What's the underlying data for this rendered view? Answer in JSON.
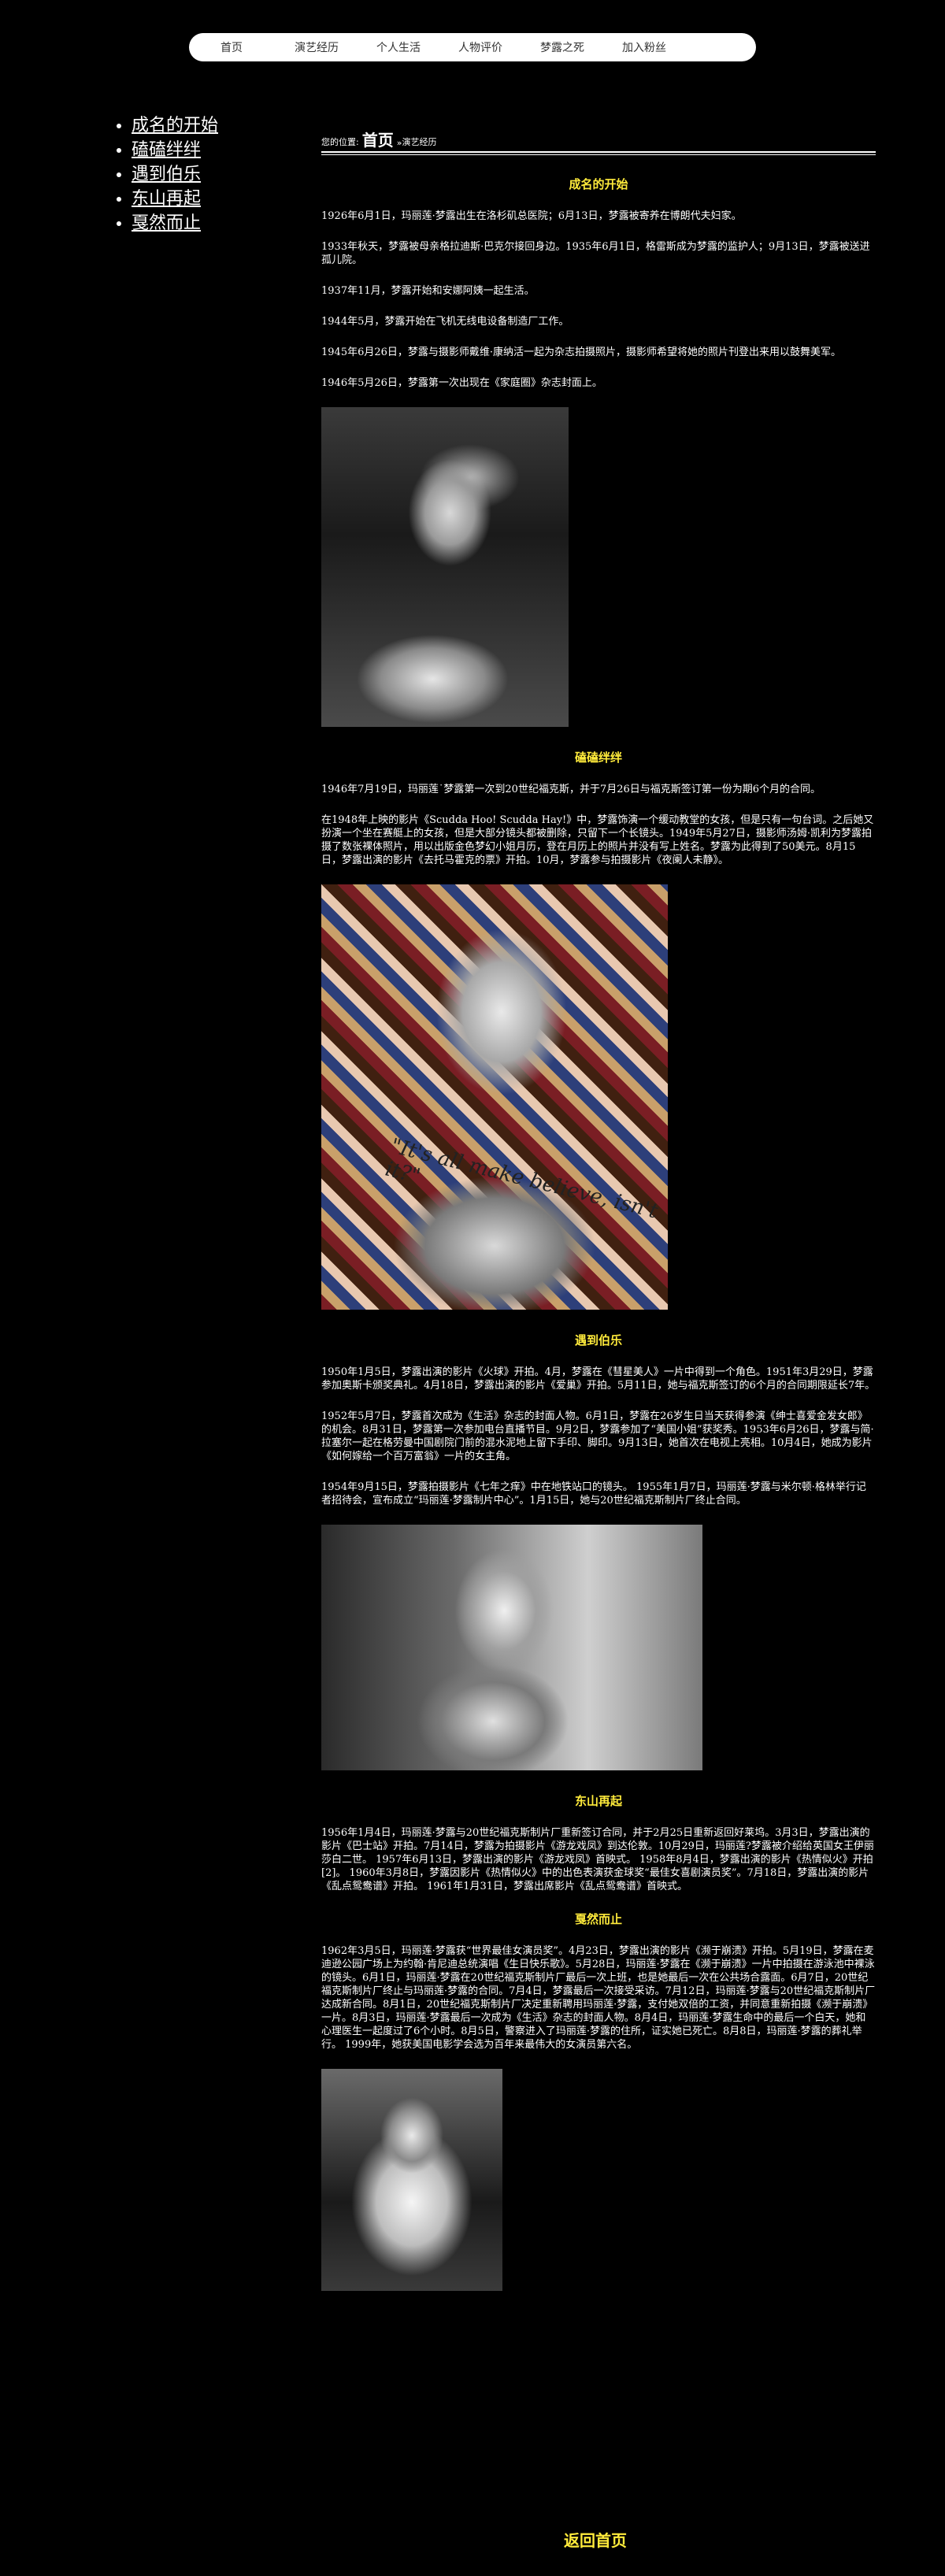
{
  "nav": {
    "items": [
      "首页",
      "演艺经历",
      "个人生活",
      "人物评价",
      "梦露之死",
      "加入粉丝"
    ]
  },
  "sidebar": {
    "items": [
      "成名的开始",
      "磕磕绊绊",
      "遇到伯乐",
      "东山再起",
      "戛然而止"
    ]
  },
  "breadcrumb": {
    "prefix": "您的位置:",
    "home": "首页",
    "separator": "»",
    "current": "演艺经历"
  },
  "sections": [
    {
      "title": "成名的开始",
      "paragraphs": [
        "1926年6月1日，玛丽莲·梦露出生在洛杉矶总医院；6月13日，梦露被寄养在博朗代夫妇家。",
        "1933年秋天，梦露被母亲格拉迪斯·巴克尔接回身边。1935年6月1日，格雷斯成为梦露的监护人；9月13日，梦露被送进孤儿院。",
        "1937年11月，梦露开始和安娜阿姨一起生活。",
        "1944年5月，梦露开始在飞机无线电设备制造厂工作。",
        "1945年6月26日，梦露与摄影师戴维·康纳活一起为杂志拍摄照片，摄影师希望将她的照片刊登出来用以鼓舞美军。",
        "1946年5月26日，梦露第一次出现在《家庭圈》杂志封面上。"
      ]
    },
    {
      "title": "磕磕绊绊",
      "paragraphs": [
        "1946年7月19日，玛丽莲˙梦露第一次到20世纪福克斯，并于7月26日与福克斯签订第一份为期6个月的合同。",
        "在1948年上映的影片《Scudda Hoo! Scudda Hay!》中，梦露饰演一个缓动教堂的女孩，但是只有一句台词。之后她又扮演一个坐在赛艇上的女孩，但是大部分镜头都被删除，只留下一个长镜头。1949年5月27日，摄影师汤姆·凯利为梦露拍摄了数张裸体照片，用以出版金色梦幻小姐月历，登在月历上的照片并没有写上姓名。梦露为此得到了50美元。8月15日，梦露出演的影片《去托马霍克的票》开拍。10月，梦露参与拍摄影片《夜阑人未静》。"
      ]
    },
    {
      "title": "遇到伯乐",
      "paragraphs": [
        "1950年1月5日，梦露出演的影片《火球》开拍。4月，梦露在《彗星美人》一片中得到一个角色。1951年3月29日，梦露参加奥斯卡颁奖典礼。4月18日，梦露出演的影片《爱巢》开拍。5月11日，她与福克斯签订的6个月的合同期限延长7年。",
        "1952年5月7日，梦露首次成为《生活》杂志的封面人物。6月1日，梦露在26岁生日当天获得参演《绅士喜爱金发女郎》的机会。8月31日，梦露第一次参加电台直播节目。9月2日，梦露参加了“美国小姐”获奖秀。1953年6月26日，梦露与简·拉塞尔一起在格劳曼中国剧院门前的混水泥地上留下手印、脚印。9月13日，她首次在电视上亮相。10月4日，她成为影片《如何嫁给一个百万富翁》一片的女主角。",
        "1954年9月15日，梦露拍摄影片《七年之痒》中在地铁站口的镜头。 1955年1月7日，玛丽莲·梦露与米尔顿·格林举行记者招待会，宣布成立“玛丽莲·梦露制片中心”。1月15日，她与20世纪福克斯制片厂终止合同。"
      ]
    },
    {
      "title": "东山再起",
      "paragraphs": [
        "1956年1月4日，玛丽莲·梦露与20世纪福克斯制片厂重新签订合同，并于2月25日重新返回好莱坞。3月3日，梦露出演的影片《巴士站》开拍。7月14日，梦露为拍摄影片《游龙戏凤》到达伦敦。10月29日，玛丽莲?梦露被介绍给英国女王伊丽莎白二世。 1957年6月13日，梦露出演的影片《游龙戏凤》首映式。 1958年8月4日，梦露出演的影片《热情似火》开拍[2]。 1960年3月8日，梦露因影片《热情似火》中的出色表演获金球奖“最佳女喜剧演员奖”。7月18日，梦露出演的影片《乱点鸳鸯谱》开拍。 1961年1月31日，梦露出席影片《乱点鸳鸯谱》首映式。"
      ]
    },
    {
      "title": "戛然而止",
      "paragraphs": [
        "1962年3月5日，玛丽莲·梦露获“世界最佳女演员奖”。4月23日，梦露出演的影片《濒于崩溃》开拍。5月19日，梦露在麦迪逊公园广场上为约翰·肯尼迪总统演唱《生日快乐歌》。5月28日，玛丽莲·梦露在《濒于崩溃》一片中拍摄在游泳池中裸泳的镜头。6月1日，玛丽莲·梦露在20世纪福克斯制片厂最后一次上班，也是她最后一次在公共场合露面。6月7日，20世纪福克斯制片厂终止与玛丽莲·梦露的合同。7月4日，梦露最后一次接受采访。7月12日，玛丽莲·梦露与20世纪福克斯制片厂达成新合同。8月1日，20世纪福克斯制片厂决定重新聘用玛丽莲·梦露，支付她双倍的工资，并同意重新拍摄《濒于崩溃》一片。8月3日，玛丽莲·梦露最后一次成为《生活》杂志的封面人物。8月4日，玛丽莲·梦露生命中的最后一个白天，她和心理医生一起度过了6个小时。8月5日，警察进入了玛丽莲·梦露的住所，证实她已死亡。8月8日，玛丽莲·梦露的葬礼举行。 1999年，她获美国电影学会选为百年来最伟大的女演员第六名。"
      ]
    }
  ],
  "images": [
    {
      "icon": "photo-monroe-covering-mouth"
    },
    {
      "icon": "photo-monroe-collage-portrait",
      "caption": "\"It's all make believe, isn't it?\""
    },
    {
      "icon": "photo-monroe-seated"
    },
    {
      "icon": "photo-monroe-bridal-veil"
    }
  ],
  "back_link": "返回首页",
  "colors": {
    "background": "#000000",
    "text": "#ffffff",
    "heading": "#ffeb3b",
    "nav_bg": "#ffffff"
  }
}
